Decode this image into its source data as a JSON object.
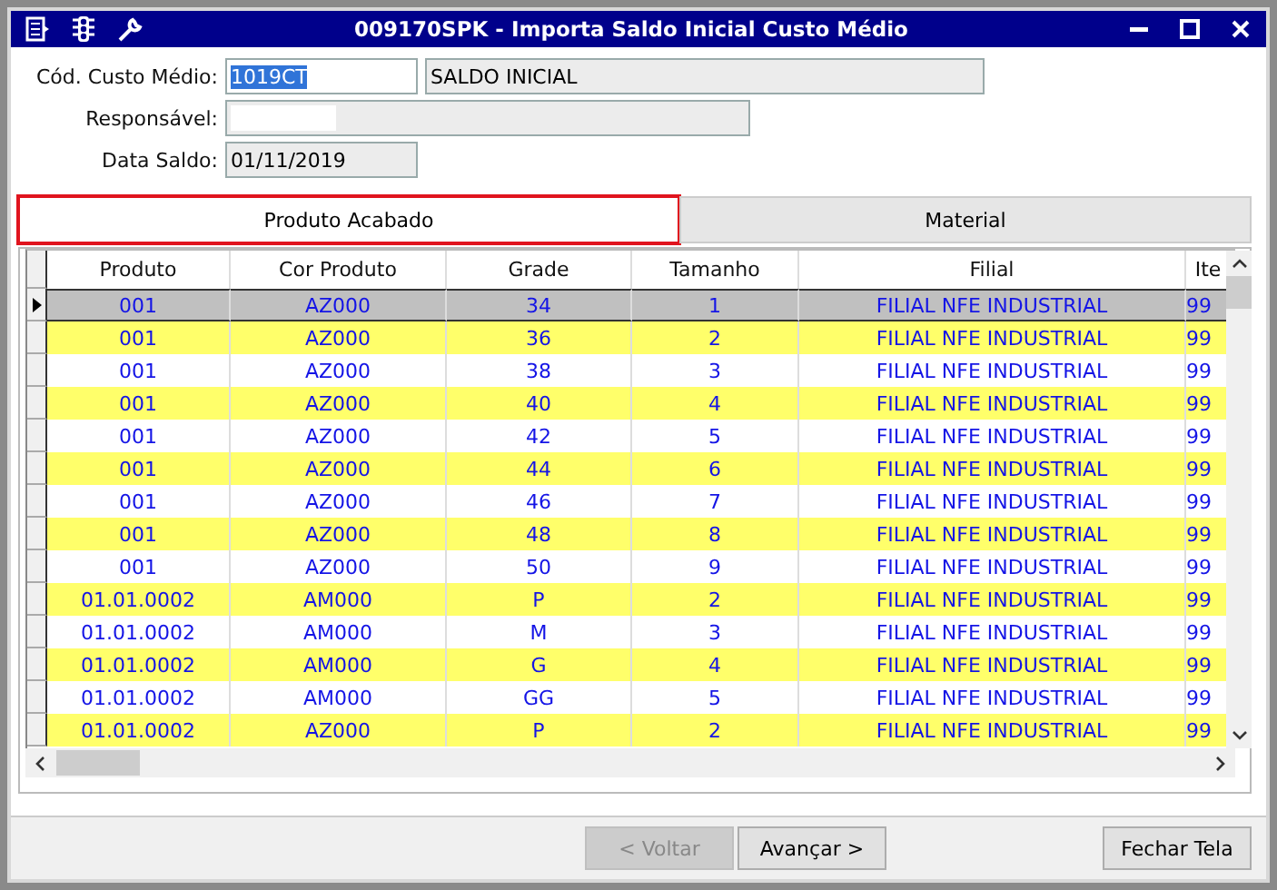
{
  "window": {
    "title": "009170SPK - Importa Saldo Inicial Custo Médio"
  },
  "form": {
    "cod_label": "Cód. Custo Médio:",
    "cod_value": "1019CT",
    "cod_description": "SALDO INICIAL",
    "responsavel_label": "Responsável:",
    "data_label": "Data Saldo:",
    "data_value": "01/11/2019"
  },
  "tabs": [
    {
      "label": "Produto Acabado",
      "selected": true,
      "highlighted": true
    },
    {
      "label": "Material",
      "selected": false,
      "highlighted": false
    }
  ],
  "table": {
    "columns": [
      "Produto",
      "Cor Produto",
      "Grade",
      "Tamanho",
      "Filial",
      "Ite"
    ],
    "rows": [
      {
        "cells": [
          "001",
          "AZ000",
          "34",
          "1",
          "FILIAL NFE INDUSTRIAL",
          "99"
        ],
        "selected": true
      },
      {
        "cells": [
          "001",
          "AZ000",
          "36",
          "2",
          "FILIAL NFE INDUSTRIAL",
          "99"
        ],
        "selected": false
      },
      {
        "cells": [
          "001",
          "AZ000",
          "38",
          "3",
          "FILIAL NFE INDUSTRIAL",
          "99"
        ],
        "selected": false
      },
      {
        "cells": [
          "001",
          "AZ000",
          "40",
          "4",
          "FILIAL NFE INDUSTRIAL",
          "99"
        ],
        "selected": false
      },
      {
        "cells": [
          "001",
          "AZ000",
          "42",
          "5",
          "FILIAL NFE INDUSTRIAL",
          "99"
        ],
        "selected": false
      },
      {
        "cells": [
          "001",
          "AZ000",
          "44",
          "6",
          "FILIAL NFE INDUSTRIAL",
          "99"
        ],
        "selected": false
      },
      {
        "cells": [
          "001",
          "AZ000",
          "46",
          "7",
          "FILIAL NFE INDUSTRIAL",
          "99"
        ],
        "selected": false
      },
      {
        "cells": [
          "001",
          "AZ000",
          "48",
          "8",
          "FILIAL NFE INDUSTRIAL",
          "99"
        ],
        "selected": false
      },
      {
        "cells": [
          "001",
          "AZ000",
          "50",
          "9",
          "FILIAL NFE INDUSTRIAL",
          "99"
        ],
        "selected": false
      },
      {
        "cells": [
          "01.01.0002",
          "AM000",
          "P",
          "2",
          "FILIAL NFE INDUSTRIAL",
          "99"
        ],
        "selected": false
      },
      {
        "cells": [
          "01.01.0002",
          "AM000",
          "M",
          "3",
          "FILIAL NFE INDUSTRIAL",
          "99"
        ],
        "selected": false
      },
      {
        "cells": [
          "01.01.0002",
          "AM000",
          "G",
          "4",
          "FILIAL NFE INDUSTRIAL",
          "99"
        ],
        "selected": false
      },
      {
        "cells": [
          "01.01.0002",
          "AM000",
          "GG",
          "5",
          "FILIAL NFE INDUSTRIAL",
          "99"
        ],
        "selected": false
      },
      {
        "cells": [
          "01.01.0002",
          "AZ000",
          "P",
          "2",
          "FILIAL NFE INDUSTRIAL",
          "99"
        ],
        "selected": false
      }
    ]
  },
  "buttons": [
    {
      "label": "< Voltar",
      "disabled": true
    },
    {
      "label": "Avançar >",
      "disabled": false
    },
    {
      "label": "Fechar Tela",
      "disabled": false
    }
  ]
}
